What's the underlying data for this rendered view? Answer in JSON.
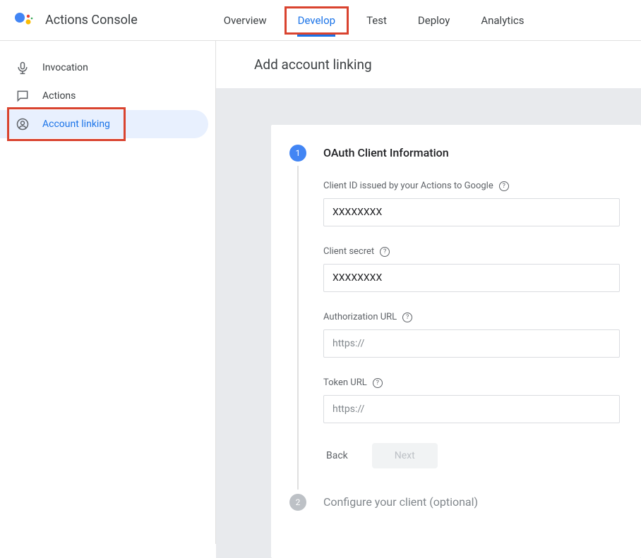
{
  "header": {
    "title": "Actions Console",
    "tabs": [
      {
        "label": "Overview",
        "active": false,
        "highlighted": false
      },
      {
        "label": "Develop",
        "active": true,
        "highlighted": true
      },
      {
        "label": "Test",
        "active": false,
        "highlighted": false
      },
      {
        "label": "Deploy",
        "active": false,
        "highlighted": false
      },
      {
        "label": "Analytics",
        "active": false,
        "highlighted": false
      }
    ]
  },
  "sidebar": {
    "items": [
      {
        "label": "Invocation",
        "icon": "mic",
        "active": false,
        "highlighted": false
      },
      {
        "label": "Actions",
        "icon": "chat",
        "active": false,
        "highlighted": false
      },
      {
        "label": "Account linking",
        "icon": "person-circle",
        "active": true,
        "highlighted": true
      }
    ]
  },
  "page": {
    "title": "Add account linking"
  },
  "form": {
    "steps": [
      {
        "number": "1",
        "title": "OAuth Client Information",
        "active": true,
        "fields": [
          {
            "label": "Client ID issued by your Actions to Google",
            "value": "XXXXXXXX",
            "placeholder": "",
            "helpIcon": true
          },
          {
            "label": "Client secret",
            "value": "XXXXXXXX",
            "placeholder": "",
            "helpIcon": true
          },
          {
            "label": "Authorization URL",
            "value": "",
            "placeholder": "https://",
            "helpIcon": true
          },
          {
            "label": "Token URL",
            "value": "",
            "placeholder": "https://",
            "helpIcon": true
          }
        ],
        "actions": {
          "back": "Back",
          "next": "Next"
        }
      },
      {
        "number": "2",
        "title": "Configure your client (optional)",
        "active": false
      }
    ]
  }
}
